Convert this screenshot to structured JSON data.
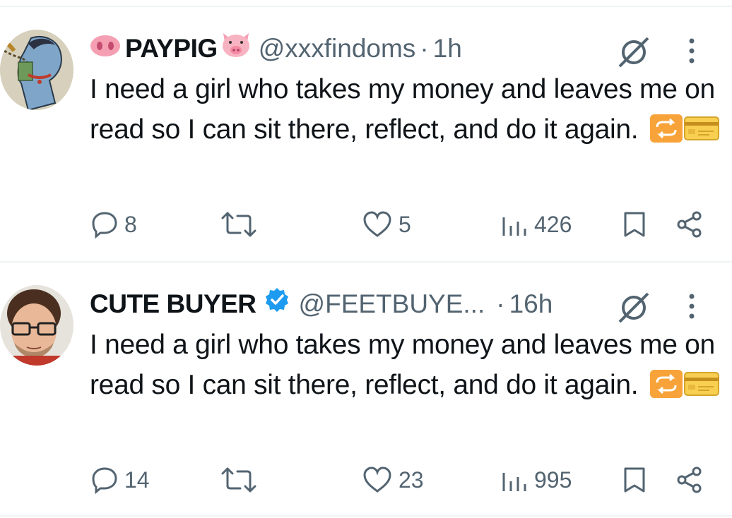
{
  "tweets": [
    {
      "name": "PAYPIG",
      "name_prefix_emoji": "pig-nose",
      "name_suffix_emoji": "pig-face",
      "verified": false,
      "handle": "@xxxfindoms",
      "separator": "·",
      "time": "1h",
      "text": "I need a girl who takes my money and leaves me on read so I can sit there, reflect, and do it again.",
      "text_emojis": [
        "repeat-emoji",
        "credit-card-emoji"
      ],
      "replies": "8",
      "reposts": "",
      "likes": "5",
      "views": "426"
    },
    {
      "name": "CUTE BUYER",
      "verified": true,
      "handle": "@FEETBUYE...",
      "separator": "·",
      "time": "16h",
      "text": "I need a girl who takes my money and leaves me on read so I can sit there, reflect, and do it again.",
      "text_emojis": [
        "repeat-emoji",
        "credit-card-emoji"
      ],
      "replies": "14",
      "reposts": "",
      "likes": "23",
      "views": "995"
    }
  ],
  "colors": {
    "text": "#0f1419",
    "secondary": "#536471",
    "divider": "#eff3f4",
    "verified": "#1d9bf0",
    "pig": "#f4a3b4"
  }
}
